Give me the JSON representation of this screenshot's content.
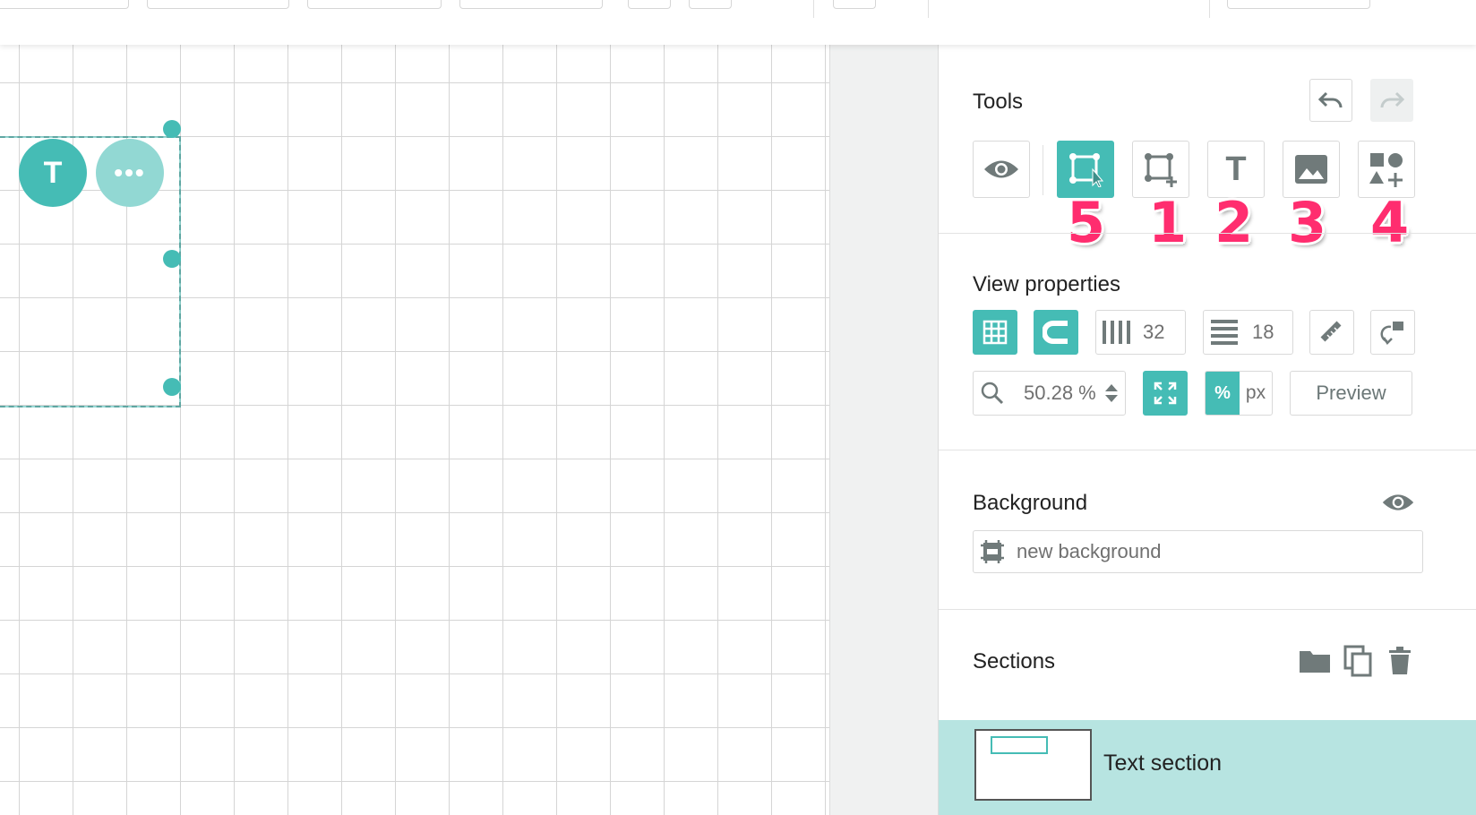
{
  "colors": {
    "accent": "#45bcb5",
    "accent_light": "#92d8d3",
    "icon_gray": "#707a7a",
    "marker": "#ff2d6f",
    "selected_row": "#b7e4e1"
  },
  "canvas": {
    "selected_block": {
      "text_button_label": "T",
      "more_button_label": "•••"
    }
  },
  "tools": {
    "title": "Tools",
    "items": [
      {
        "name": "preview-eye",
        "icon": "eye-icon"
      },
      {
        "name": "select-tool",
        "icon": "select-box-icon",
        "active": true,
        "marker": "5"
      },
      {
        "name": "add-box-tool",
        "icon": "box-plus-icon",
        "marker": "1"
      },
      {
        "name": "text-tool",
        "icon": "text-icon",
        "label": "T",
        "marker": "2"
      },
      {
        "name": "image-tool",
        "icon": "image-icon",
        "marker": "3"
      },
      {
        "name": "shapes-tool",
        "icon": "shapes-plus-icon",
        "marker": "4"
      }
    ],
    "undo_icon": "undo-icon",
    "redo_icon": "redo-icon"
  },
  "view_properties": {
    "title": "View properties",
    "columns_value": "32",
    "rows_value": "18",
    "zoom_value": "50.28 %",
    "unit_percent": "%",
    "unit_px": "px",
    "preview_label": "Preview"
  },
  "background": {
    "title": "Background",
    "placeholder": "new background"
  },
  "sections": {
    "title": "Sections",
    "items": [
      {
        "label": "Text section",
        "selected": true
      }
    ]
  }
}
